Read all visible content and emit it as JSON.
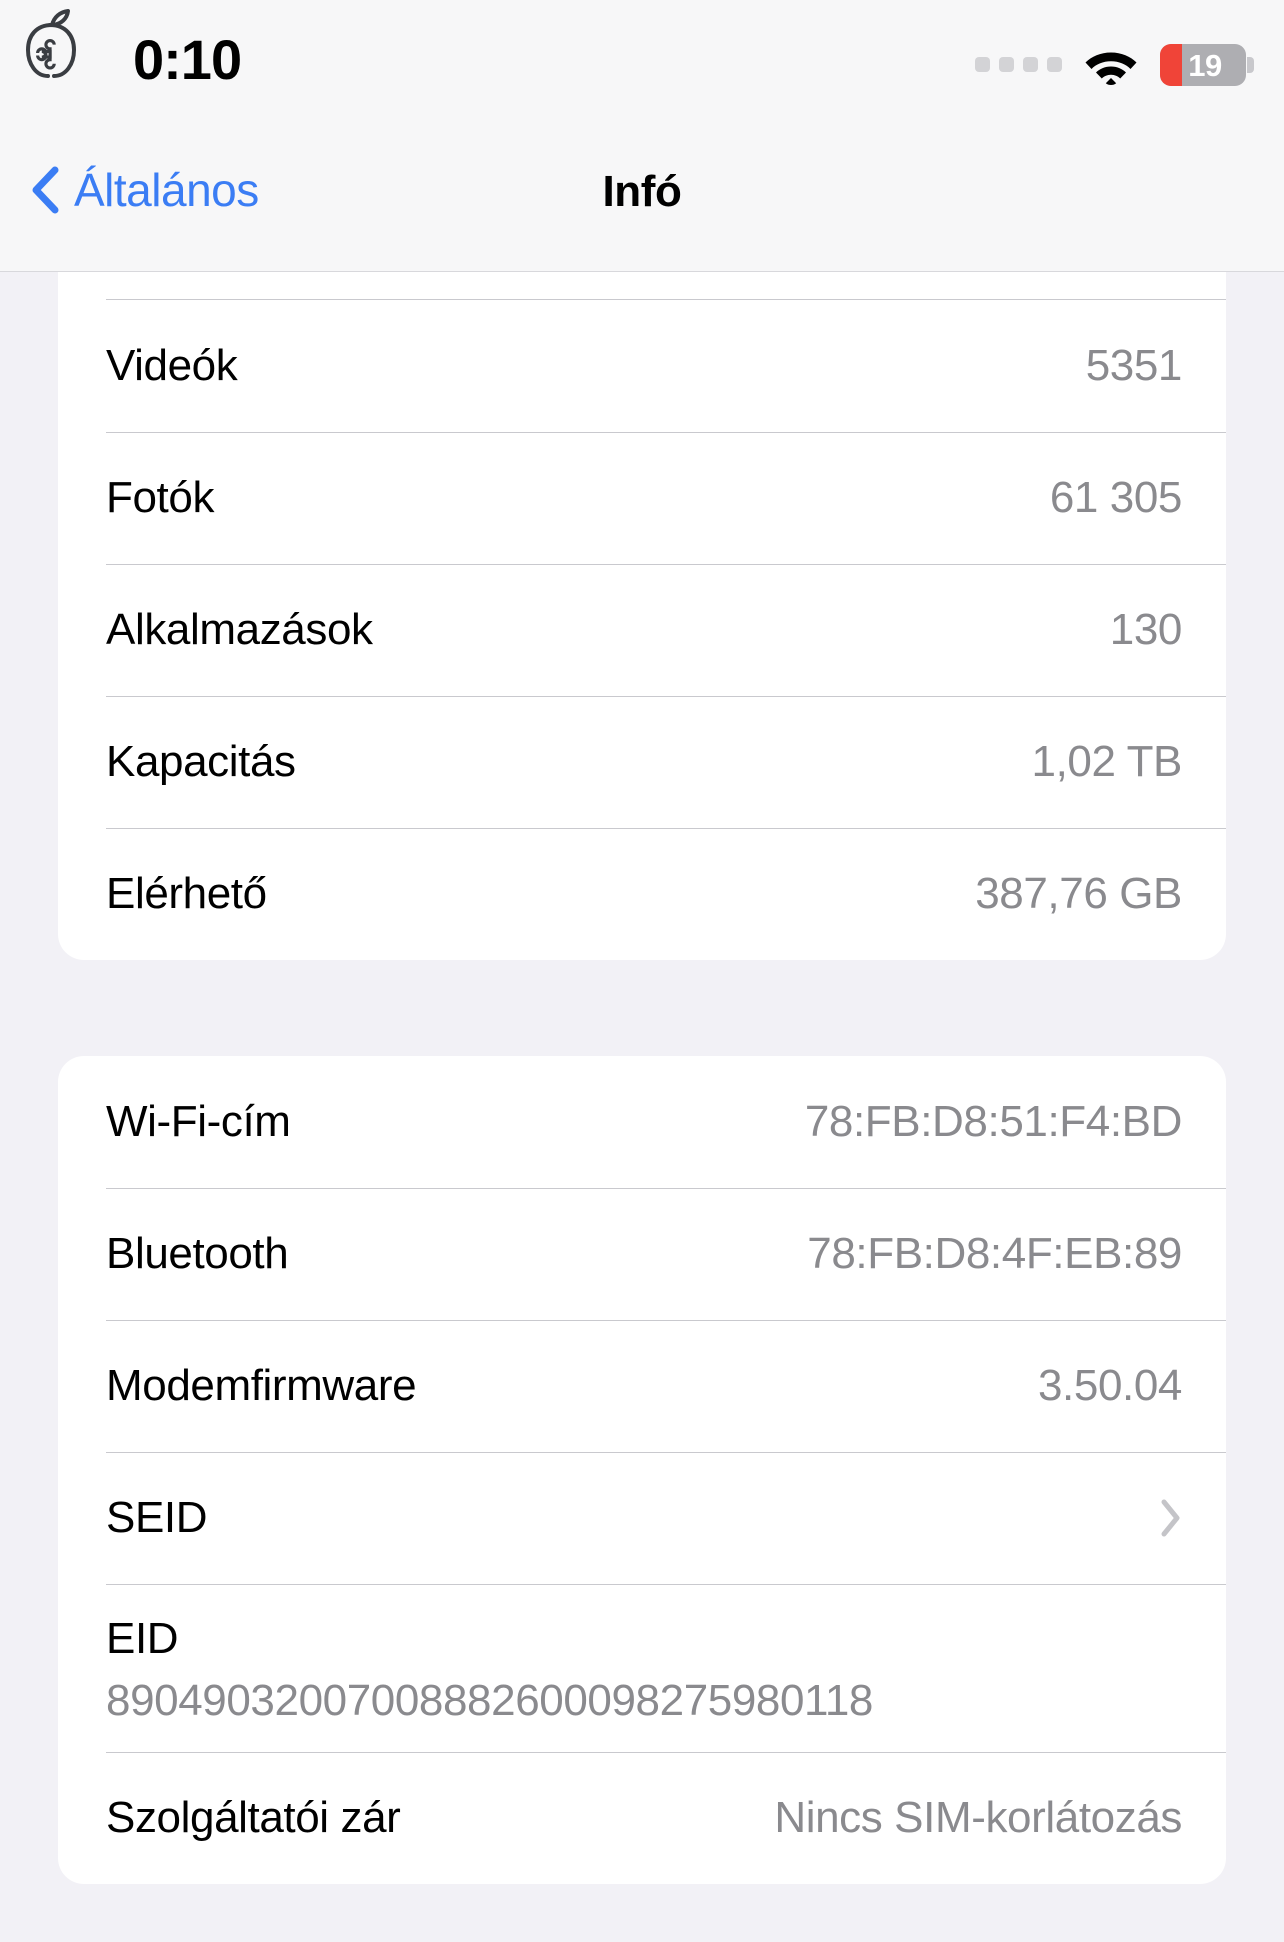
{
  "status_bar": {
    "time": "0:10",
    "recording_icon": "apple-command-outline-icon",
    "signal_icon": "signal-dots-icon",
    "wifi_icon": "wifi-icon",
    "battery_icon": "battery-icon",
    "battery_level": "19",
    "battery_percent": 19,
    "battery_fill_color": "#F04438",
    "battery_body_color": "#AEAEB2"
  },
  "nav": {
    "back_icon": "chevron-left-icon",
    "back_label": "Általános",
    "title": "Infó",
    "accent_color": "#3B7DF4"
  },
  "sections": [
    {
      "name": "storage-section",
      "rows": [
        {
          "label": "Videók",
          "value": "5351",
          "type": "value"
        },
        {
          "label": "Fotók",
          "value": "61 305",
          "type": "value"
        },
        {
          "label": "Alkalmazások",
          "value": "130",
          "type": "value"
        },
        {
          "label": "Kapacitás",
          "value": "1,02 TB",
          "type": "value"
        },
        {
          "label": "Elérhető",
          "value": "387,76 GB",
          "type": "value"
        }
      ]
    },
    {
      "name": "hardware-section",
      "rows": [
        {
          "label": "Wi-Fi-cím",
          "value": "78:FB:D8:51:F4:BD",
          "type": "value"
        },
        {
          "label": "Bluetooth",
          "value": "78:FB:D8:4F:EB:89",
          "type": "value"
        },
        {
          "label": "Modemfirmware",
          "value": "3.50.04",
          "type": "value"
        },
        {
          "label": "SEID",
          "value": "",
          "type": "disclosure",
          "icon": "chevron-right-icon"
        },
        {
          "label": "EID",
          "value": "89049032007008882600098275980118",
          "type": "stacked"
        },
        {
          "label": "Szolgáltatói zár",
          "value": "Nincs SIM-korlátozás",
          "type": "value"
        }
      ]
    }
  ],
  "colors": {
    "page_background": "#F2F1F6",
    "card_background": "#FFFFFF",
    "separator": "#C9C9CE",
    "value_text": "#8A8A8E",
    "label_text": "#000000",
    "chevron": "#C4C4C8"
  }
}
